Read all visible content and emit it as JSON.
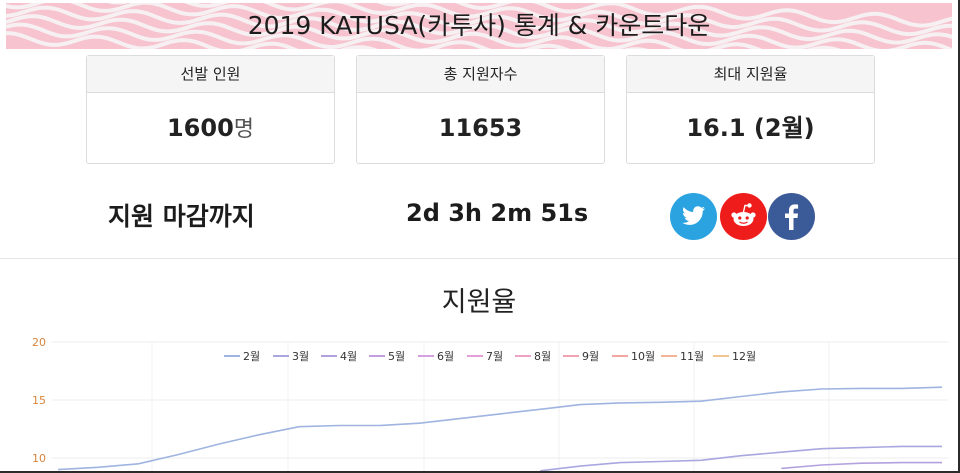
{
  "header": {
    "title": "2019 KATUSA(카투사) 통계 & 카운트다운"
  },
  "stats": [
    {
      "label": "선발 인원",
      "value": "1600",
      "unit": "명"
    },
    {
      "label": "총 지원자수",
      "value": "11653",
      "unit": ""
    },
    {
      "label": "최대 지원율",
      "value": "16.1 (2월)",
      "unit": ""
    }
  ],
  "countdown": {
    "label": "지원 마감까지",
    "remaining": "2d 3h 2m 51s"
  },
  "social": [
    {
      "name": "twitter",
      "color": "#2aa3e0"
    },
    {
      "name": "reddit",
      "color": "#ef1c1c"
    },
    {
      "name": "facebook",
      "color": "#3b5a98"
    }
  ],
  "chart_title": "지원율",
  "chart_data": {
    "type": "line",
    "y_ticks": [
      "20",
      "15",
      "10"
    ],
    "ylim_visible": [
      9,
      20
    ],
    "grid": true,
    "legend_position": "top-center",
    "series": [
      {
        "name": "2월",
        "color": "#9fb4e0",
        "values": [
          9.0,
          9.2,
          9.5,
          10.3,
          11.2,
          12.0,
          12.7,
          12.8,
          12.8,
          13.0,
          13.4,
          13.8,
          14.2,
          14.6,
          14.75,
          14.8,
          14.9,
          15.3,
          15.7,
          15.95,
          16.0,
          16.0,
          16.1
        ]
      },
      {
        "name": "3월",
        "color": "#a9a7df",
        "values": [
          null,
          null,
          null,
          null,
          null,
          null,
          null,
          null,
          null,
          null,
          null,
          null,
          8.9,
          9.3,
          9.6,
          9.7,
          9.8,
          10.2,
          10.5,
          10.8,
          10.9,
          11.0,
          11.0
        ]
      },
      {
        "name": "4월",
        "color": "#b3a1df",
        "values": [
          null,
          null,
          null,
          null,
          null,
          null,
          null,
          null,
          null,
          null,
          null,
          null,
          null,
          null,
          null,
          null,
          null,
          null,
          9.1,
          9.4,
          9.55,
          9.6,
          9.6
        ]
      },
      {
        "name": "5월",
        "color": "#c39fdf",
        "values": []
      },
      {
        "name": "6월",
        "color": "#d6a0e0",
        "values": []
      },
      {
        "name": "7월",
        "color": "#e3a0d8",
        "values": []
      },
      {
        "name": "8월",
        "color": "#eda2c6",
        "values": []
      },
      {
        "name": "9월",
        "color": "#f0a3b2",
        "values": []
      },
      {
        "name": "10월",
        "color": "#f2a8a1",
        "values": []
      },
      {
        "name": "11월",
        "color": "#f2b497",
        "values": []
      },
      {
        "name": "12월",
        "color": "#f1c592",
        "values": []
      }
    ]
  }
}
